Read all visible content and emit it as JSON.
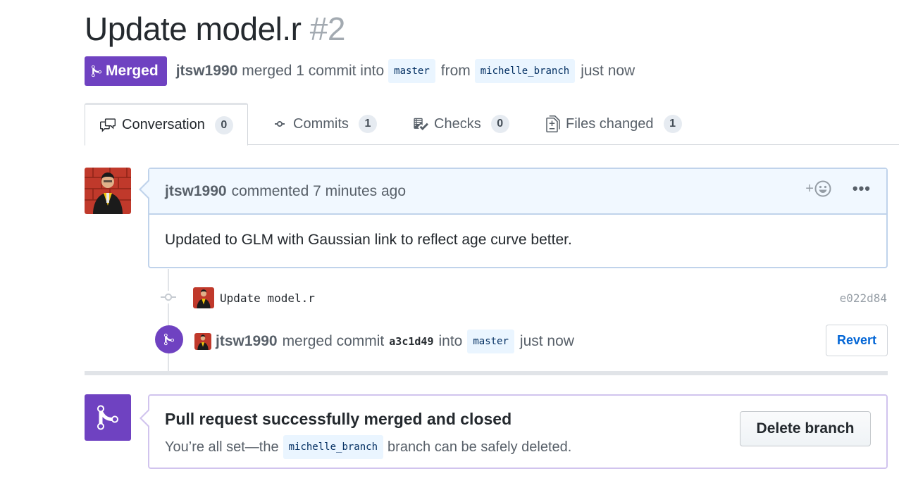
{
  "pr": {
    "title": "Update model.r",
    "number": "#2"
  },
  "status": {
    "badge": "Merged",
    "author": "jtsw1990",
    "text_merged": "merged 1 commit into",
    "base_branch": "master",
    "text_from": "from",
    "head_branch": "michelle_branch",
    "time": "just now"
  },
  "tabs": [
    {
      "label": "Conversation",
      "count": "0",
      "icon": "comment-discussion-icon"
    },
    {
      "label": "Commits",
      "count": "1",
      "icon": "git-commit-icon"
    },
    {
      "label": "Checks",
      "count": "0",
      "icon": "checklist-icon"
    },
    {
      "label": "Files changed",
      "count": "1",
      "icon": "file-diff-icon"
    }
  ],
  "comment": {
    "author": "jtsw1990",
    "meta": "commented 7 minutes ago",
    "reaction_plus": "+",
    "menu_dots": "•••",
    "body": "Updated to GLM with Gaussian link to reflect age curve better."
  },
  "commit": {
    "message": "Update model.r",
    "sha": "e022d84"
  },
  "merge_event": {
    "author": "jtsw1990",
    "text_merged": "merged commit",
    "sha": "a3c1d49",
    "text_into": "into",
    "branch": "master",
    "time": "just now",
    "revert_label": "Revert"
  },
  "merged_box": {
    "heading": "Pull request successfully merged and closed",
    "sub_before": "You’re all set—the",
    "branch": "michelle_branch",
    "sub_after": "branch can be safely deleted.",
    "delete_label": "Delete branch"
  },
  "colors": {
    "merged_purple": "#6f42c1",
    "link_blue": "#0366d6",
    "branch_bg": "#eaf5ff",
    "header_bg": "#f1f8ff"
  }
}
